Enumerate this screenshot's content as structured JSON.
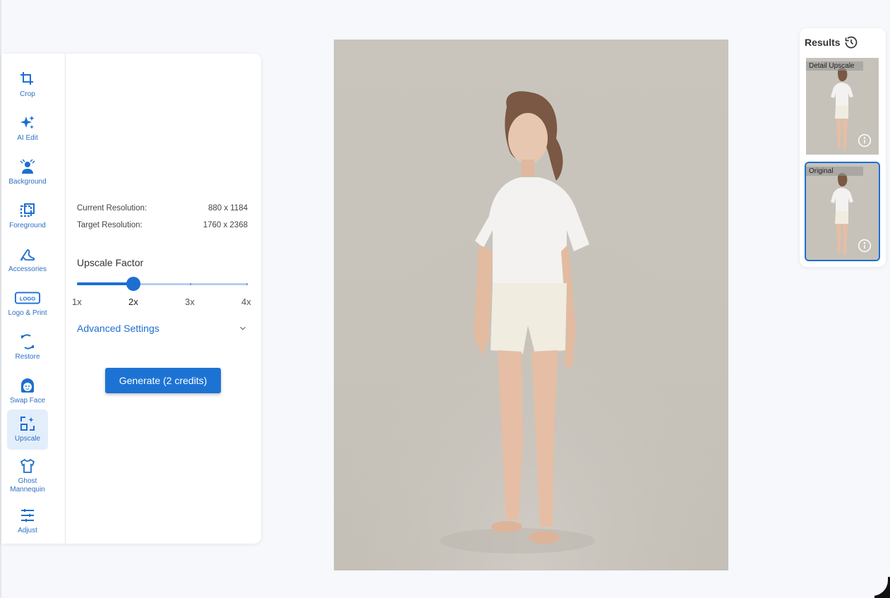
{
  "toolbar": {
    "items": [
      {
        "label": "Crop",
        "icon": "crop-icon"
      },
      {
        "label": "AI Edit",
        "icon": "sparkle-icon"
      },
      {
        "label": "Background",
        "icon": "background-icon"
      },
      {
        "label": "Foreground",
        "icon": "foreground-icon"
      },
      {
        "label": "Accessories",
        "icon": "high-heel-icon"
      },
      {
        "label": "Logo & Print",
        "icon": "logo-icon"
      },
      {
        "label": "Restore",
        "icon": "restore-icon"
      },
      {
        "label": "Swap Face",
        "icon": "face-icon"
      },
      {
        "label": "Upscale",
        "icon": "upscale-icon"
      },
      {
        "label": "Ghost Mannequin",
        "icon": "shirt-icon"
      },
      {
        "label": "Adjust",
        "icon": "sliders-icon"
      }
    ],
    "active": "Upscale",
    "logo_text": "LOGO"
  },
  "settings": {
    "current_resolution_label": "Current Resolution:",
    "current_resolution_value": "880 x 1184",
    "target_resolution_label": "Target Resolution:",
    "target_resolution_value": "1760 x 2368",
    "upscale_factor_label": "Upscale Factor",
    "factor_options": [
      "1x",
      "2x",
      "3x",
      "4x"
    ],
    "selected_factor": "2x",
    "advanced_label": "Advanced Settings",
    "generate_label": "Generate (2 credits)"
  },
  "results": {
    "title": "Results",
    "items": [
      {
        "label": "Detail Upscale"
      },
      {
        "label": "Original"
      }
    ]
  },
  "colors": {
    "accent": "#1d6fd0",
    "background": "#f6f8fb"
  }
}
